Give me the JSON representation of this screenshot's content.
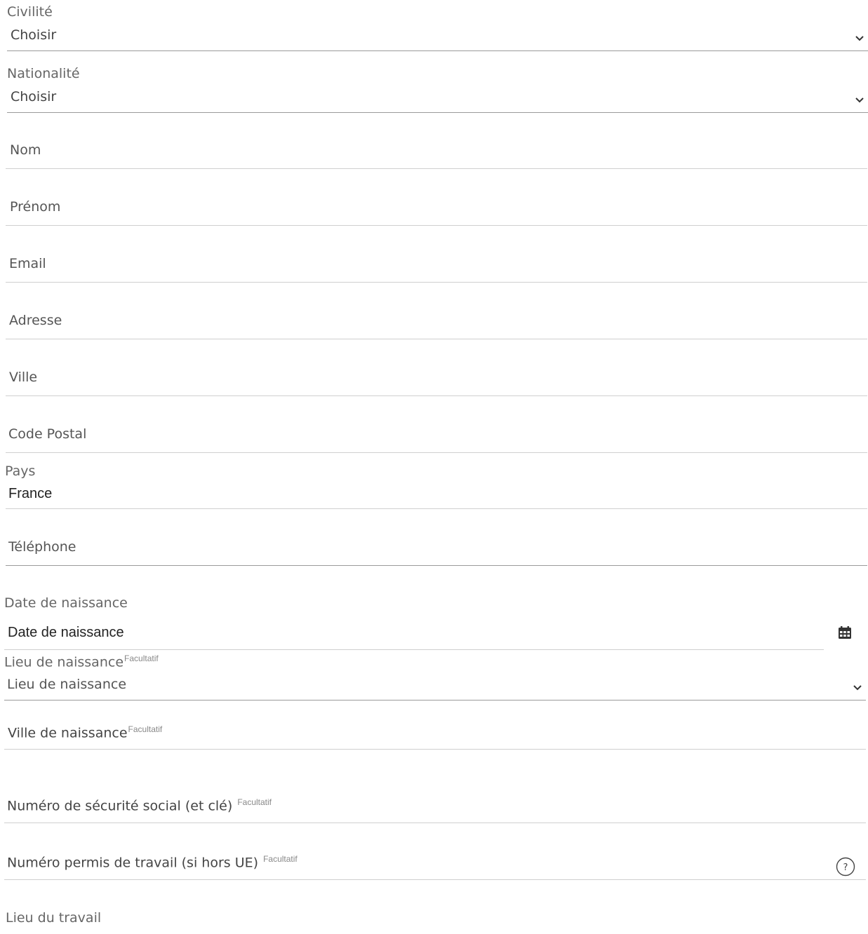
{
  "form": {
    "civilite": {
      "label": "Civilité",
      "value": "Choisir"
    },
    "nationalite": {
      "label": "Nationalité",
      "value": "Choisir"
    },
    "nom": {
      "placeholder": "Nom"
    },
    "prenom": {
      "placeholder": "Prénom"
    },
    "email": {
      "placeholder": "Email"
    },
    "adresse": {
      "placeholder": "Adresse"
    },
    "ville": {
      "placeholder": "Ville"
    },
    "code_postal": {
      "placeholder": "Code Postal"
    },
    "pays": {
      "label": "Pays",
      "value": "France"
    },
    "telephone": {
      "placeholder": "Téléphone"
    },
    "date_naissance": {
      "label": "Date de naissance",
      "placeholder": "Date de naissance"
    },
    "lieu_naissance": {
      "label": "Lieu de naissance",
      "optional": "Facultatif",
      "placeholder": "Lieu de naissance"
    },
    "ville_naissance": {
      "placeholder": "Ville de naissance",
      "optional": "Facultatif"
    },
    "secu": {
      "placeholder": "Numéro de sécurité social (et clé)",
      "optional": "Facultatif"
    },
    "permis": {
      "placeholder": "Numéro permis de travail (si hors UE)",
      "optional": "Facultatif",
      "help_icon": "question-circle-icon"
    },
    "lieu_travail": {
      "label": "Lieu du travail"
    }
  },
  "icons": {
    "select_arrow": "chevron-down-icon",
    "calendar": "calendar-icon"
  },
  "colors": {
    "text": "#555555",
    "line": "#cfcfcf"
  }
}
